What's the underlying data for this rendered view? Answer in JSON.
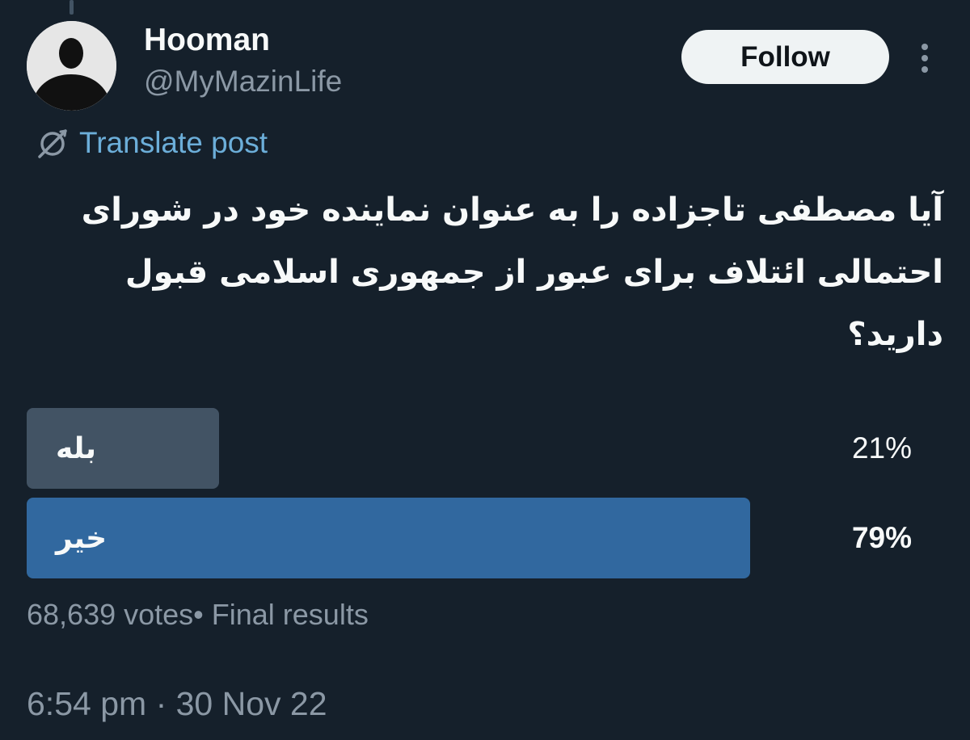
{
  "colors": {
    "background": "#15202b",
    "text_primary": "#f7f9f9",
    "text_secondary": "#8b98a5",
    "link": "#6caed9",
    "poll_bar_default": "#425364",
    "poll_bar_winner": "#31689f",
    "follow_button_bg": "#eff3f4"
  },
  "author": {
    "display_name": "Hooman",
    "handle": "@MyMazinLife",
    "avatar_icon": "person-silhouette-avatar"
  },
  "actions": {
    "follow_label": "Follow",
    "more_icon": "more-vertical-icon"
  },
  "translate": {
    "icon": "globe-translate-icon",
    "label": "Translate post"
  },
  "post": {
    "text": "آیا مصطفی تاجزاده را به عنوان نماینده خود در شورای احتمالی ائتلاف برای عبور از جمهوری اسلامی قبول دارید؟"
  },
  "poll": {
    "options": [
      {
        "label": "بله",
        "percent_text": "21%",
        "percent": 21,
        "winner": false
      },
      {
        "label": "خیر",
        "percent_text": "79%",
        "percent": 79,
        "winner": true
      }
    ],
    "votes": "68,639 votes",
    "status": "Final results"
  },
  "timestamp": {
    "time": "6:54 pm",
    "separator": "·",
    "date": "30 Nov 22"
  }
}
